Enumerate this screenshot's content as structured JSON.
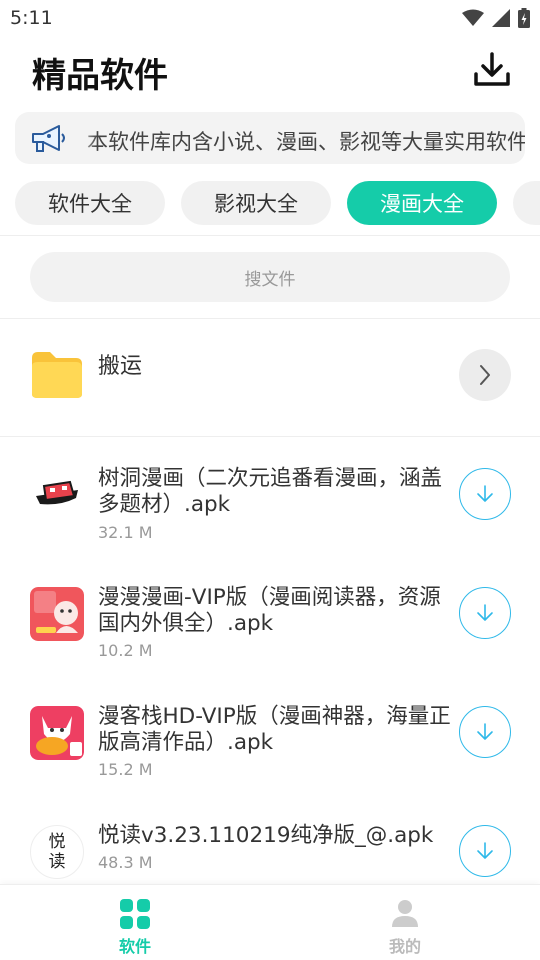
{
  "status_bar": {
    "time": "5:11"
  },
  "header": {
    "title": "精品软件"
  },
  "notice": {
    "text": "本软件库内含小说、漫画、影视等大量实用软件"
  },
  "tabs": [
    {
      "label": "软件大全",
      "active": false
    },
    {
      "label": "影视大全",
      "active": false
    },
    {
      "label": "漫画大全",
      "active": true
    }
  ],
  "search": {
    "placeholder": "搜文件"
  },
  "folder": {
    "name": "搬运"
  },
  "files": [
    {
      "name": "树洞漫画（二次元追番看漫画，涵盖多题材）.apk",
      "size": "32.1 M",
      "icon": "shudong-app-icon"
    },
    {
      "name": "漫漫漫画-VIP版（漫画阅读器，资源国内外俱全）.apk",
      "size": "10.2 M",
      "icon": "manman-app-icon"
    },
    {
      "name": "漫客栈HD-VIP版（漫画神器，海量正版高清作品）.apk",
      "size": "15.2 M",
      "icon": "mankezhan-app-icon"
    },
    {
      "name": "悦读v3.23.110219纯净版_@.apk",
      "size": "48.3 M",
      "icon": "yuedu-app-icon",
      "icon_text": "悦读"
    }
  ],
  "bottom_nav": [
    {
      "label": "软件",
      "active": true
    },
    {
      "label": "我的",
      "active": false
    }
  ],
  "colors": {
    "accent": "#15cca9",
    "download": "#2fb9e9",
    "folder": "#ffd34e"
  }
}
